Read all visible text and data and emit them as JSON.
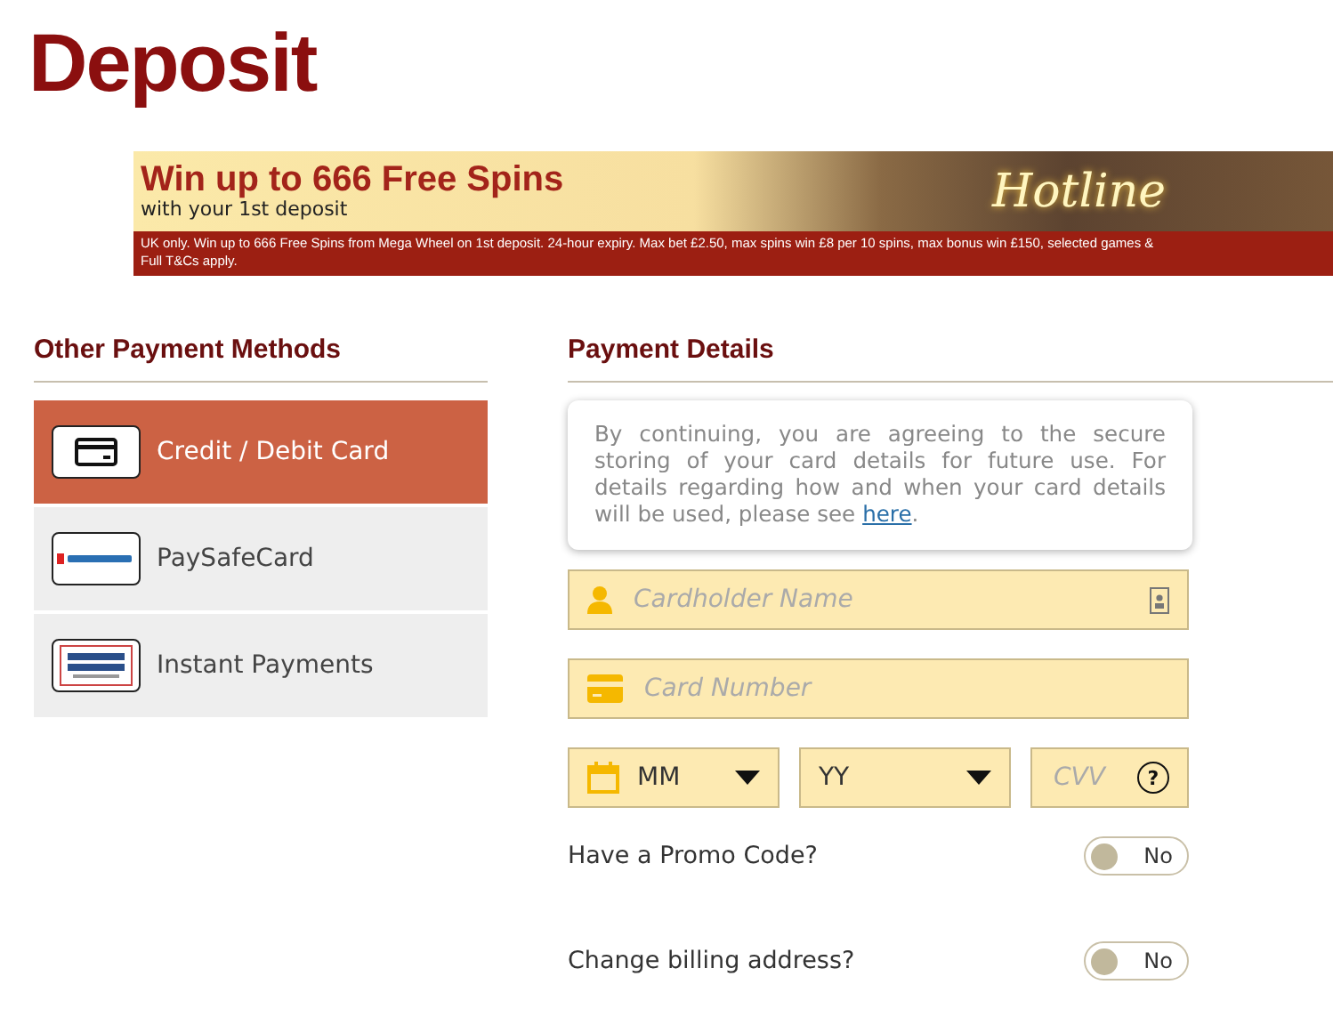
{
  "page_title": "Deposit",
  "banner": {
    "headline": "Win up to 666 Free Spins",
    "subline": "with your 1st deposit",
    "logo": "Hotline",
    "terms": [
      "UK only. Win up to 666 Free Spins from Mega Wheel on 1st deposit. 24-hour expiry. Max bet £2.50, max spins win £8 per 10 spins, max bonus win £150, selected games &",
      "Full T&Cs apply."
    ]
  },
  "methods": {
    "heading": "Other Payment Methods",
    "items": [
      {
        "label": "Credit / Debit Card",
        "kind": "card",
        "selected": true
      },
      {
        "label": "PaySafeCard",
        "kind": "paysafe",
        "selected": false
      },
      {
        "label": "Instant Payments",
        "kind": "instant",
        "selected": false
      }
    ]
  },
  "details": {
    "heading": "Payment Details",
    "notice": "By continuing, you are agreeing to the secure storing of your card details for future use. For details regarding how and when your card details will be used, please see",
    "notice_link": "here",
    "notice_end": ".",
    "cardholder": {
      "placeholder": "Cardholder Name"
    },
    "card_number": {
      "placeholder": "Card Number"
    },
    "month": {
      "value": "MM"
    },
    "year": {
      "value": "YY"
    },
    "cvv": {
      "placeholder": "CVV",
      "help": "?"
    },
    "toggles": [
      {
        "label": "Have a Promo Code?",
        "on": false,
        "state_label": "No"
      },
      {
        "label": "Change billing address?",
        "on": false,
        "state_label": "No"
      }
    ]
  }
}
